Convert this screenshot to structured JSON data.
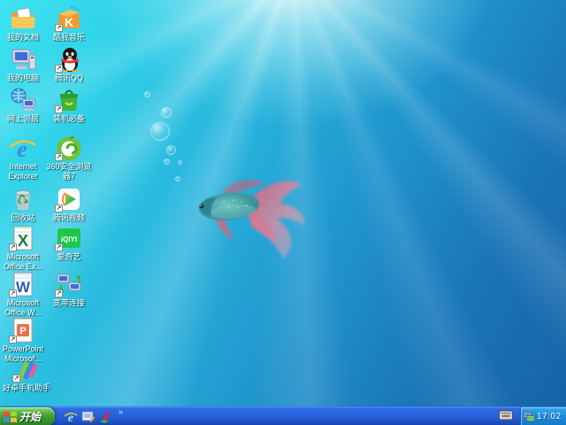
{
  "desktop": {
    "icons": [
      {
        "name": "my-documents",
        "label": "我的文档",
        "shortcut": false
      },
      {
        "name": "kuwo-music",
        "label": "酷我音乐",
        "shortcut": true
      },
      {
        "name": "my-computer",
        "label": "我的电脑",
        "shortcut": false
      },
      {
        "name": "tencent-qq",
        "label": "腾讯QQ",
        "shortcut": true
      },
      {
        "name": "network-places",
        "label": "网上邻居",
        "shortcut": false
      },
      {
        "name": "zhuangji-bibei",
        "label": "装机必备",
        "shortcut": true
      },
      {
        "name": "internet-explorer",
        "label": "Internet\nExplorer",
        "shortcut": false
      },
      {
        "name": "360-safe-browser",
        "label": "360安全浏览\n器7",
        "shortcut": true
      },
      {
        "name": "recycle-bin",
        "label": "回收站",
        "shortcut": false
      },
      {
        "name": "tencent-video",
        "label": "腾讯视频",
        "shortcut": true
      },
      {
        "name": "ms-office-excel",
        "label": "Microsoft\nOffice Ex...",
        "shortcut": true
      },
      {
        "name": "iqiyi",
        "label": "爱奇艺",
        "shortcut": true
      },
      {
        "name": "ms-office-word",
        "label": "Microsoft\nOffice W...",
        "shortcut": true
      },
      {
        "name": "broadband-connection",
        "label": "宽带连接",
        "shortcut": true
      },
      {
        "name": "powerpoint",
        "label": "PowerPoint\nMicrosof...",
        "shortcut": true
      },
      {
        "name": "haozhuo-phone-assistant",
        "label": "好卓手机助手",
        "shortcut": true
      }
    ],
    "wallpaper": {
      "theme": "underwater light rays with betta fish and bubbles",
      "colors": {
        "light_cyan": "#3ee4f0",
        "mid_blue": "#1f93cc",
        "deep_blue": "#1562a6",
        "fish_body": "#3f9aa0",
        "fish_fins": "#e85a70"
      }
    }
  },
  "taskbar": {
    "start_label": "开始",
    "quick_launch": [
      {
        "name": "internet-explorer-launcher"
      },
      {
        "name": "show-desktop"
      },
      {
        "name": "media-swoosh-launcher"
      }
    ],
    "overflow_chevron": "»",
    "tray": {
      "input_indicator": "keyboard-icon",
      "network_status": "network-status-icon",
      "clock": "17:02"
    },
    "colors": {
      "taskbar_blue": "#2763dd",
      "start_green": "#3c9631",
      "tray_blue": "#1b8ada"
    }
  }
}
